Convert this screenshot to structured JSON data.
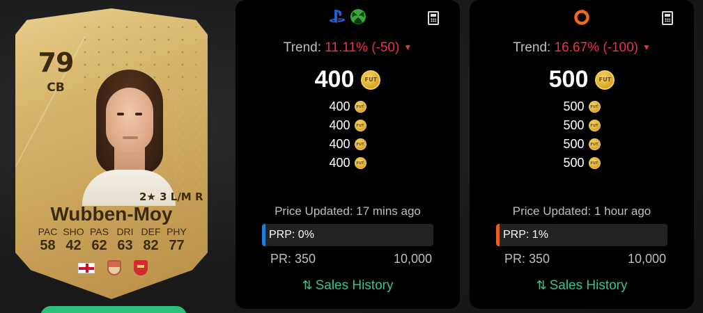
{
  "player_card": {
    "rating": "79",
    "position": "CB",
    "name": "Wubben-Moy",
    "skills": "2★ 3 L/M R",
    "stats": [
      {
        "label": "PAC",
        "value": "58"
      },
      {
        "label": "SHO",
        "value": "42"
      },
      {
        "label": "PAS",
        "value": "62"
      },
      {
        "label": "DRI",
        "value": "63"
      },
      {
        "label": "DEF",
        "value": "82"
      },
      {
        "label": "PHY",
        "value": "77"
      }
    ],
    "badges": {
      "nation_icon": "england-flag-icon",
      "league_icon": "league-badge-icon",
      "club_icon": "club-crest-icon"
    }
  },
  "panels": [
    {
      "id": "console",
      "icons": [
        "playstation-icon",
        "xbox-icon"
      ],
      "trend_label": "Trend:",
      "trend_value": "11.11% (-50)",
      "price": "400",
      "recent_prices": [
        "400",
        "400",
        "400",
        "400"
      ],
      "updated": "Price Updated: 17 mins ago",
      "prp": "PRP: 0%",
      "prp_accent": "#1d7fd8",
      "pr_min": "PR: 350",
      "pr_max": "10,000",
      "sales_history": "Sales History"
    },
    {
      "id": "pc",
      "icons": [
        "origin-icon"
      ],
      "trend_label": "Trend:",
      "trend_value": "16.67% (-100)",
      "price": "500",
      "recent_prices": [
        "500",
        "500",
        "500",
        "500"
      ],
      "updated": "Price Updated: 1 hour ago",
      "prp": "PRP: 1%",
      "prp_accent": "#e2621c",
      "pr_min": "PR: 350",
      "pr_max": "10,000",
      "sales_history": "Sales History"
    }
  ],
  "coin_text": "FUT",
  "colors": {
    "trend_down": "#e8334a",
    "sales_link": "#35c687",
    "card_gold": "#d7b56c"
  }
}
